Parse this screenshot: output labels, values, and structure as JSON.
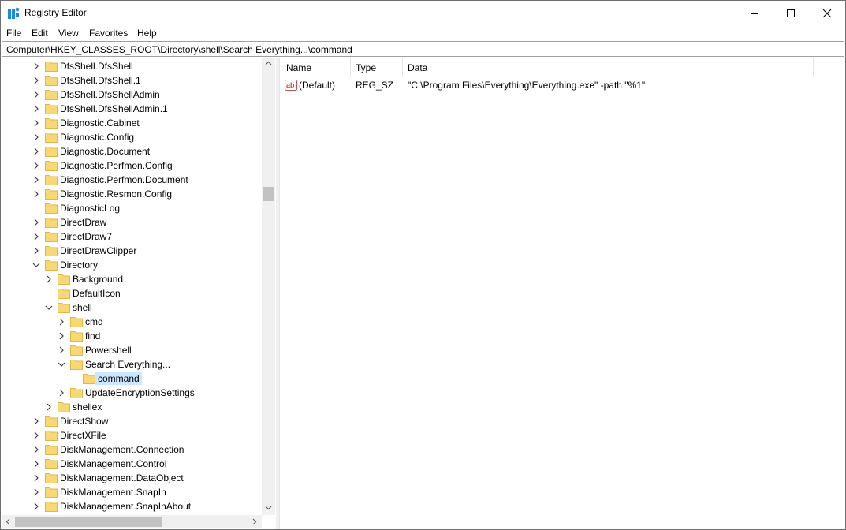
{
  "window": {
    "title": "Registry Editor"
  },
  "menu": [
    "File",
    "Edit",
    "View",
    "Favorites",
    "Help"
  ],
  "address": "Computer\\HKEY_CLASSES_ROOT\\Directory\\shell\\Search Everything...\\command",
  "tree": [
    {
      "label": "DfsShell.DfsShell",
      "level": 0,
      "expander": "collapsed"
    },
    {
      "label": "DfsShell.DfsShell.1",
      "level": 0,
      "expander": "collapsed"
    },
    {
      "label": "DfsShell.DfsShellAdmin",
      "level": 0,
      "expander": "collapsed"
    },
    {
      "label": "DfsShell.DfsShellAdmin.1",
      "level": 0,
      "expander": "collapsed"
    },
    {
      "label": "Diagnostic.Cabinet",
      "level": 0,
      "expander": "collapsed"
    },
    {
      "label": "Diagnostic.Config",
      "level": 0,
      "expander": "collapsed"
    },
    {
      "label": "Diagnostic.Document",
      "level": 0,
      "expander": "collapsed"
    },
    {
      "label": "Diagnostic.Perfmon.Config",
      "level": 0,
      "expander": "collapsed"
    },
    {
      "label": "Diagnostic.Perfmon.Document",
      "level": 0,
      "expander": "collapsed"
    },
    {
      "label": "Diagnostic.Resmon.Config",
      "level": 0,
      "expander": "collapsed"
    },
    {
      "label": "DiagnosticLog",
      "level": 0,
      "expander": "none"
    },
    {
      "label": "DirectDraw",
      "level": 0,
      "expander": "collapsed"
    },
    {
      "label": "DirectDraw7",
      "level": 0,
      "expander": "collapsed"
    },
    {
      "label": "DirectDrawClipper",
      "level": 0,
      "expander": "collapsed"
    },
    {
      "label": "Directory",
      "level": 0,
      "expander": "expanded"
    },
    {
      "label": "Background",
      "level": 1,
      "expander": "collapsed"
    },
    {
      "label": "DefaultIcon",
      "level": 1,
      "expander": "none"
    },
    {
      "label": "shell",
      "level": 1,
      "expander": "expanded"
    },
    {
      "label": "cmd",
      "level": 2,
      "expander": "collapsed"
    },
    {
      "label": "find",
      "level": 2,
      "expander": "collapsed"
    },
    {
      "label": "Powershell",
      "level": 2,
      "expander": "collapsed"
    },
    {
      "label": "Search Everything...",
      "level": 2,
      "expander": "expanded"
    },
    {
      "label": "command",
      "level": 3,
      "expander": "none",
      "selected": true
    },
    {
      "label": "UpdateEncryptionSettings",
      "level": 2,
      "expander": "collapsed"
    },
    {
      "label": "shellex",
      "level": 1,
      "expander": "collapsed"
    },
    {
      "label": "DirectShow",
      "level": 0,
      "expander": "collapsed"
    },
    {
      "label": "DirectXFile",
      "level": 0,
      "expander": "collapsed"
    },
    {
      "label": "DiskManagement.Connection",
      "level": 0,
      "expander": "collapsed"
    },
    {
      "label": "DiskManagement.Control",
      "level": 0,
      "expander": "collapsed"
    },
    {
      "label": "DiskManagement.DataObject",
      "level": 0,
      "expander": "collapsed"
    },
    {
      "label": "DiskManagement.SnapIn",
      "level": 0,
      "expander": "collapsed"
    },
    {
      "label": "DiskManagement.SnapInAbout",
      "level": 0,
      "expander": "collapsed"
    }
  ],
  "list": {
    "columns": [
      "Name",
      "Type",
      "Data"
    ],
    "rows": [
      {
        "name": "(Default)",
        "type": "REG_SZ",
        "data": "\"C:\\Program Files\\Everything\\Everything.exe\" -path \"%1\"",
        "icon": "string-value-icon"
      }
    ]
  },
  "colors": {
    "folder": "#f8d775",
    "folder_edge": "#e0b84a",
    "selection": "#cce8ff",
    "accent": "#0078d7"
  }
}
